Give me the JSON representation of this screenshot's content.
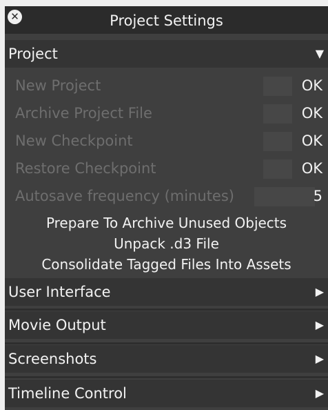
{
  "window": {
    "title": "Project Settings",
    "close_icon": "close-icon"
  },
  "project": {
    "label": "Project",
    "expanded": true,
    "rows": [
      {
        "label": "New Project",
        "button": "OK"
      },
      {
        "label": "Archive Project File",
        "button": "OK"
      },
      {
        "label": "New Checkpoint",
        "button": "OK"
      },
      {
        "label": "Restore Checkpoint",
        "button": "OK"
      }
    ],
    "autosave": {
      "label": "Autosave frequency (minutes)",
      "value": "5"
    },
    "actions": [
      "Prepare To Archive Unused Objects",
      "Unpack .d3 File",
      "Consolidate Tagged Files Into Assets"
    ]
  },
  "sections": [
    {
      "label": "User Interface",
      "expanded": false
    },
    {
      "label": "Movie Output",
      "expanded": false
    },
    {
      "label": "Screenshots",
      "expanded": false
    },
    {
      "label": "Timeline Control",
      "expanded": false
    }
  ],
  "colors": {
    "panel_bg": "#3f3f3f",
    "header_bg": "#343434",
    "titlebar_bg": "#2b2b2b",
    "text": "#f2f2f2",
    "disabled_text": "#6e6e6e"
  }
}
